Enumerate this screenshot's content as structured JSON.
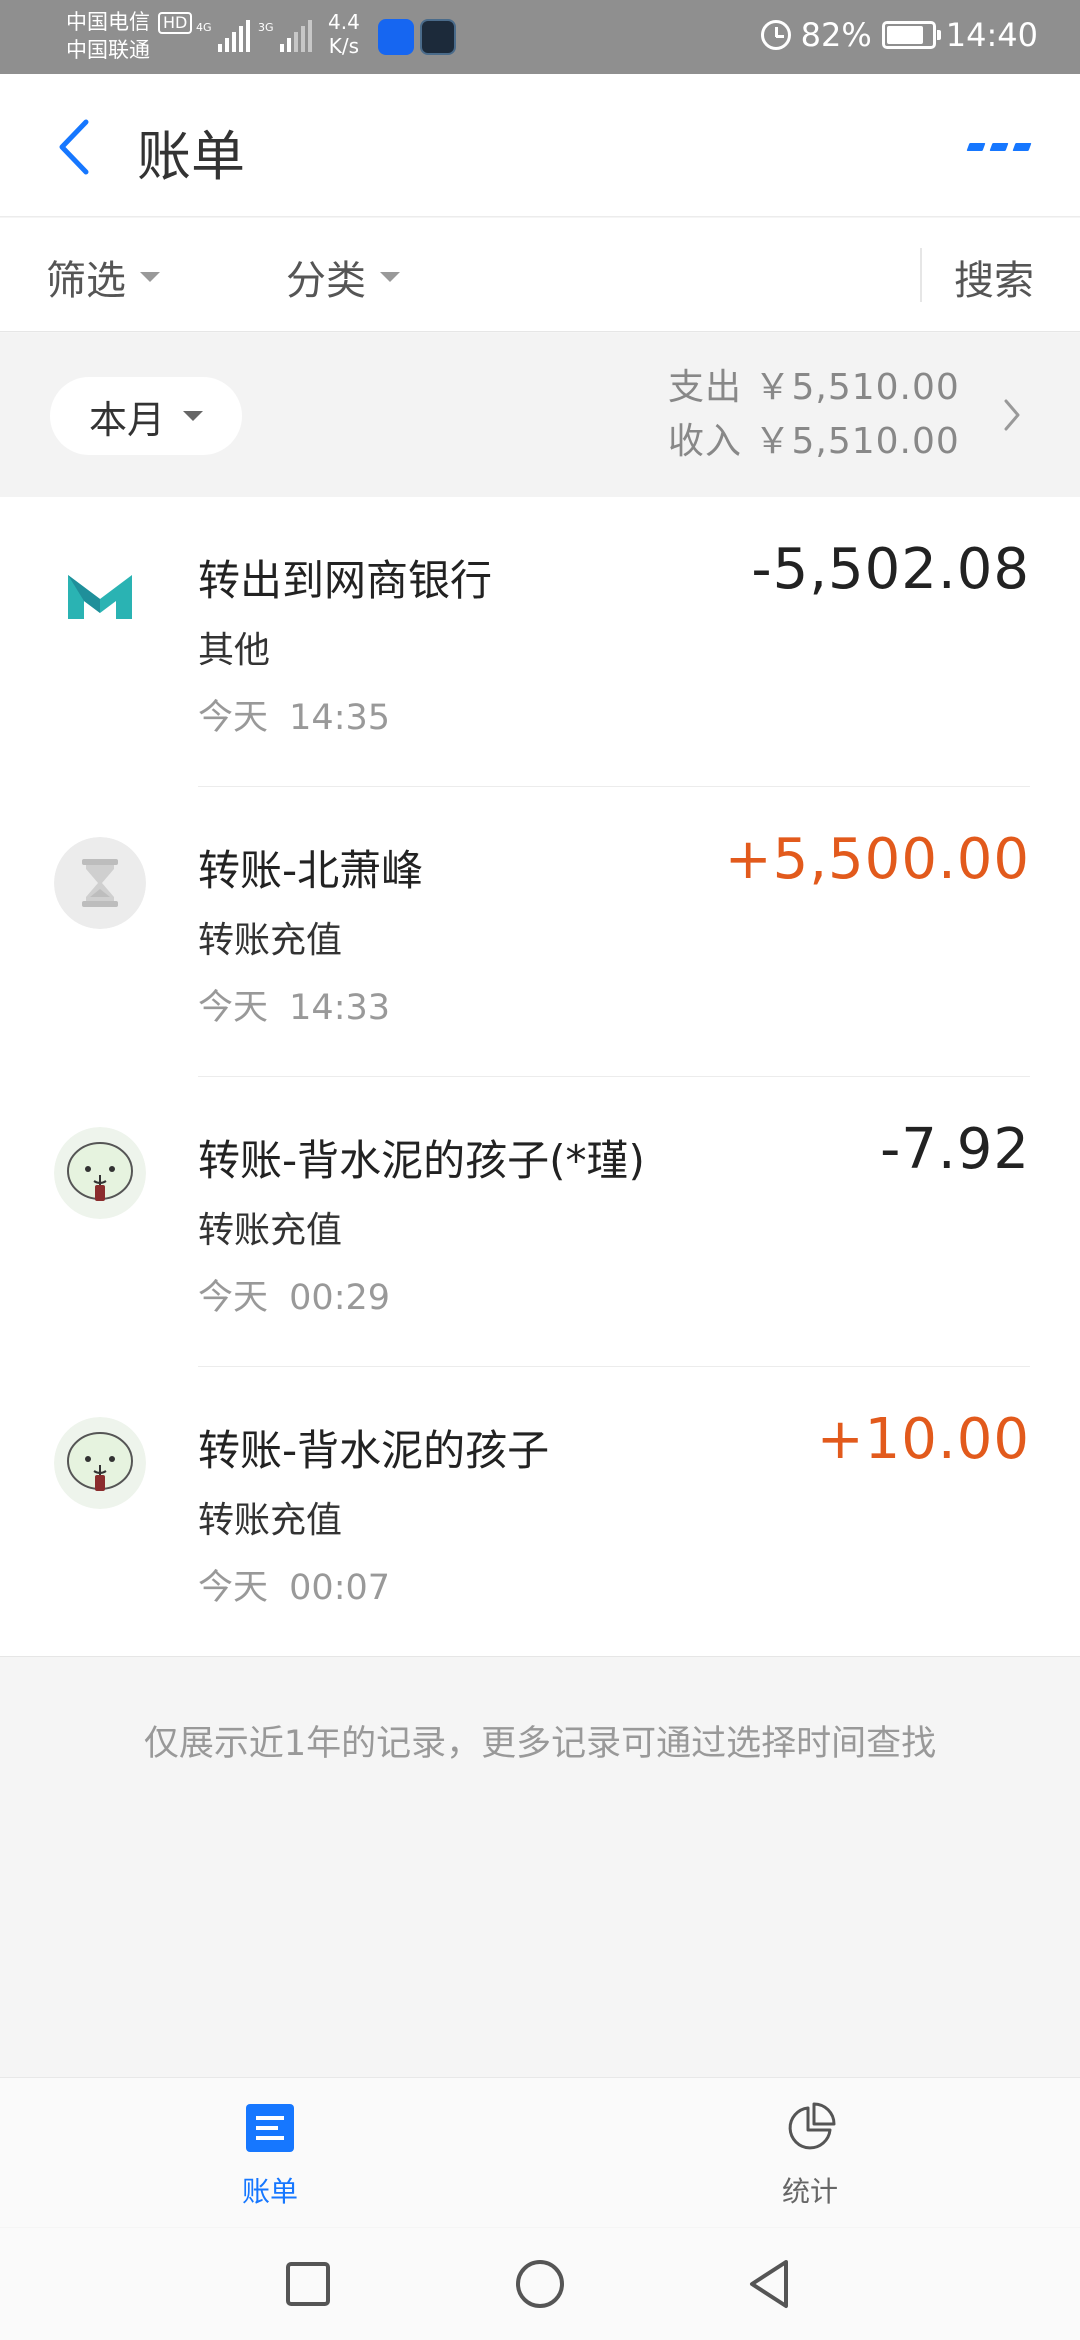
{
  "status_bar": {
    "carrier_1": "中国电信",
    "carrier_2": "中国联通",
    "hd": "HD",
    "net_1": "4G",
    "net_2": "3G",
    "speed_value": "4.4",
    "speed_unit": "K/s",
    "battery_percent": "82%",
    "battery_level": 0.82,
    "time": "14:40"
  },
  "header": {
    "title": "账单"
  },
  "filters": {
    "filter_label": "筛选",
    "category_label": "分类",
    "search_label": "搜索"
  },
  "month": {
    "selector_label": "本月",
    "expense_label": "支出",
    "expense_amount": "￥5,510.00",
    "income_label": "收入",
    "income_amount": "￥5,510.00"
  },
  "records": [
    {
      "title": "转出到网商银行",
      "category": "其他",
      "date": "今天",
      "time": "14:35",
      "amount": "-5,502.08",
      "type": "expense",
      "icon": "mybank-logo-icon"
    },
    {
      "title": "转账-北萧峰",
      "category": "转账充值",
      "date": "今天",
      "time": "14:33",
      "amount": "+5,500.00",
      "type": "income",
      "icon": "hourglass-icon"
    },
    {
      "title": "转账-背水泥的孩子(*瑾)",
      "category": "转账充值",
      "date": "今天",
      "time": "00:29",
      "amount": "-7.92",
      "type": "expense",
      "icon": "cartoon-avatar-icon"
    },
    {
      "title": "转账-背水泥的孩子",
      "category": "转账充值",
      "date": "今天",
      "time": "00:07",
      "amount": "+10.00",
      "type": "income",
      "icon": "cartoon-avatar-icon"
    }
  ],
  "footnote": "仅展示近1年的记录，更多记录可通过选择时间查找",
  "tabs": [
    {
      "label": "账单",
      "icon": "bill-list-icon",
      "active": true
    },
    {
      "label": "统计",
      "icon": "pie-chart-icon",
      "active": false
    }
  ],
  "colors": {
    "accent": "#1677ff",
    "income": "#e25a1c",
    "expense": "#222222"
  }
}
